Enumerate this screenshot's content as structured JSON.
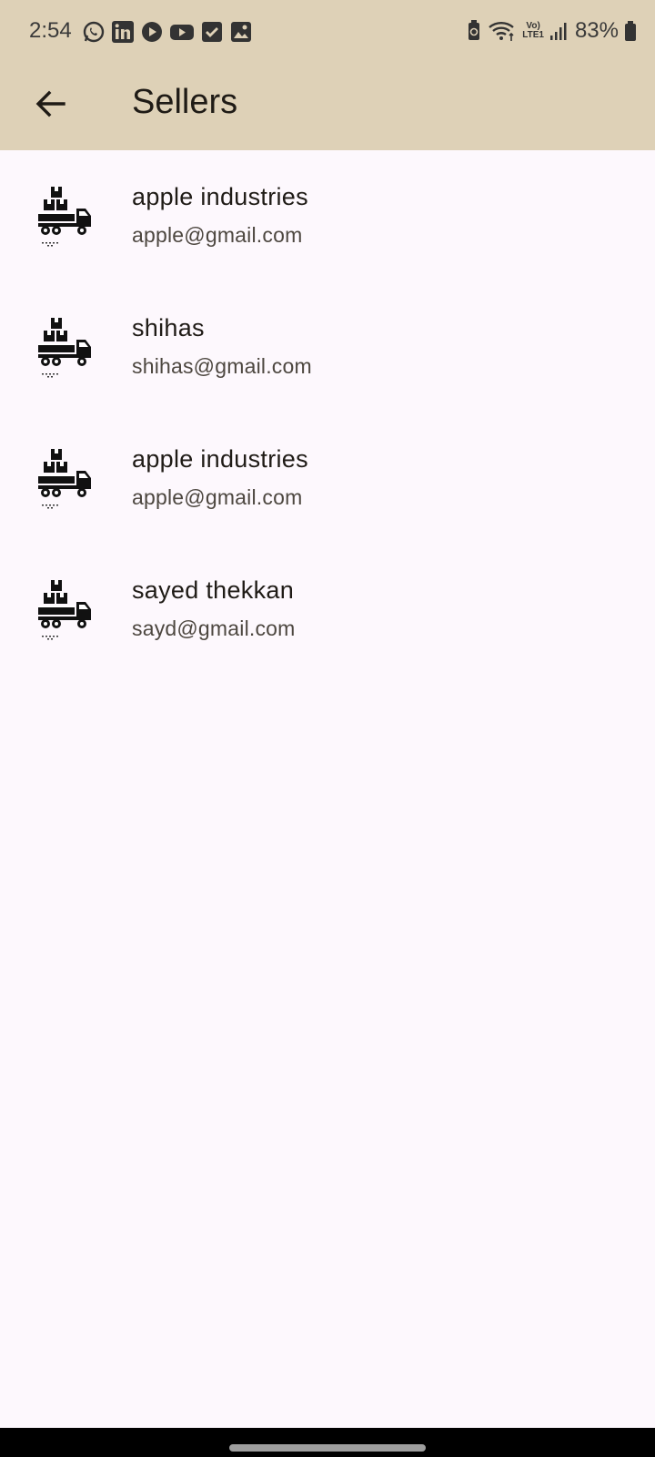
{
  "status_bar": {
    "time": "2:54",
    "battery": "83%",
    "left_icons": [
      "whatsapp-icon",
      "linkedin-icon",
      "play-icon",
      "youtube-icon",
      "check-icon",
      "gallery-icon"
    ],
    "right_icons": [
      "battery-saver-icon",
      "wifi-icon",
      "volte-icon",
      "signal-icon",
      "battery-icon"
    ],
    "volte_label": "Vo)",
    "lte_label": "LTE1"
  },
  "app_bar": {
    "title": "Sellers",
    "back_icon": "arrow-back-icon",
    "background": "#ded1b7"
  },
  "sellers": [
    {
      "name": "apple industries",
      "email": "apple@gmail.com",
      "icon": "delivery-truck-icon"
    },
    {
      "name": "shihas",
      "email": "shihas@gmail.com",
      "icon": "delivery-truck-icon"
    },
    {
      "name": "apple industries",
      "email": "apple@gmail.com",
      "icon": "delivery-truck-icon"
    },
    {
      "name": "sayed thekkan",
      "email": "sayd@gmail.com",
      "icon": "delivery-truck-icon"
    }
  ],
  "colors": {
    "page_background": "#fdf8fd",
    "header_background": "#ded1b7",
    "primary_text": "#1f1b16",
    "secondary_text": "#4d4740"
  }
}
